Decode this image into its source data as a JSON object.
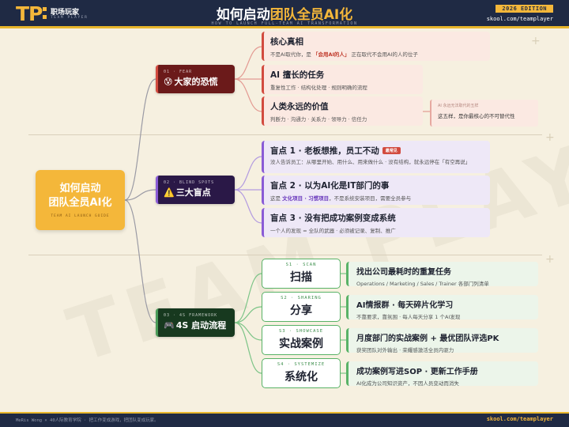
{
  "header": {
    "logo_mark": "TP",
    "logo_cn": "职场玩家",
    "logo_en": "TEAM PLAYER",
    "title_pre": "如何启动",
    "title_hl": "团队全员AI化",
    "subtitle": "HOW TO LAUNCH FULL-TEAM AI TRANSFORMATION",
    "edition": "2026 EDITION",
    "site": "skool.com/teamplayer"
  },
  "footer": {
    "left": "MeRis Wong × 40人际教育学院 · 把工作变成游戏，把团队变成玩家。",
    "right": "skool.com/teamplayer"
  },
  "watermark": "TEAM PLAYER",
  "colors": {
    "accent": "#f4b73a",
    "navy": "#1f2a44",
    "fear": "#d24b3f",
    "blind": "#8a5cd6",
    "framework": "#4a9b58"
  },
  "root": {
    "line1": "如何启动",
    "line2": "团队全员AI化",
    "tag": "TEAM AI LAUNCH GUIDE"
  },
  "branches": {
    "fear": {
      "tag": "01 · FEAR",
      "emoji": "😰",
      "title": "大家的恐慌",
      "items": [
        {
          "title": "核心真相",
          "desc_pre": "不是AI取代你，是 ",
          "desc_em": "「会用AI的人」",
          "desc_post": " 正在取代不会用AI的人的位子"
        },
        {
          "title": "AI 擅长的任务",
          "desc": "重复性工作 · 结构化处理 · 规则明确的流程"
        },
        {
          "title": "人类永远的价值",
          "desc": "判断力 · 沟通力 · 关系力 · 领导力 · 信任力"
        }
      ],
      "side_note": {
        "small": "AI 永远无法取代的五样",
        "text": "这五样，是你最核心的不可替代性"
      }
    },
    "blind": {
      "tag": "02 · BLIND SPOTS",
      "emoji": "⚠️",
      "title": "三大盲点",
      "items": [
        {
          "title": "盲点 1 · 老板想推，员工不动",
          "badge": "最常见",
          "desc": "没人告诉员工：从哪里开始、用什么、用来做什么 · 没有结构，就永远停在「有空再说」"
        },
        {
          "title": "盲点 2 · 以为AI化是IT部门的事",
          "desc_pre": "这是 ",
          "desc_em": "文化项目 · 习惯项目",
          "desc_post": "，不是系统安装项目，需要全员参与"
        },
        {
          "title": "盲点 3 · 没有把成功案例变成系统",
          "desc": "一个人的发现 = 全队的武器 · 必须被记录、复制、推广"
        }
      ]
    },
    "framework": {
      "tag": "03 · 4S FRAMEWORK",
      "emoji": "🎮",
      "title": "4S 启动流程",
      "steps": [
        {
          "tag": "S1 · SCAN",
          "title": "扫描",
          "detail_title": "找出公司最耗时的重复任务",
          "detail_desc": "Operations / Marketing / Sales / Trainer 各部门列清单"
        },
        {
          "tag": "S2 · SHARING",
          "title": "分享",
          "detail_title": "AI情报群 · 每天碎片化学习",
          "detail_desc": "不靠要求，靠氛围 · 每人每天分享 1 个AI发现"
        },
        {
          "tag": "S3 · SHOWCASE",
          "title": "实战案例",
          "detail_title": "月度部门的实战案例 + 最优团队评选PK",
          "detail_desc": "获奖团队对外输出 · 荣耀感激活全员内驱力"
        },
        {
          "tag": "S4 · SYSTEMIZE",
          "title": "系统化",
          "detail_title": "成功案例写进SOP · 更新工作手册",
          "detail_desc": "AI化成为公司知识资产，不因人员变动而消失"
        }
      ]
    }
  }
}
